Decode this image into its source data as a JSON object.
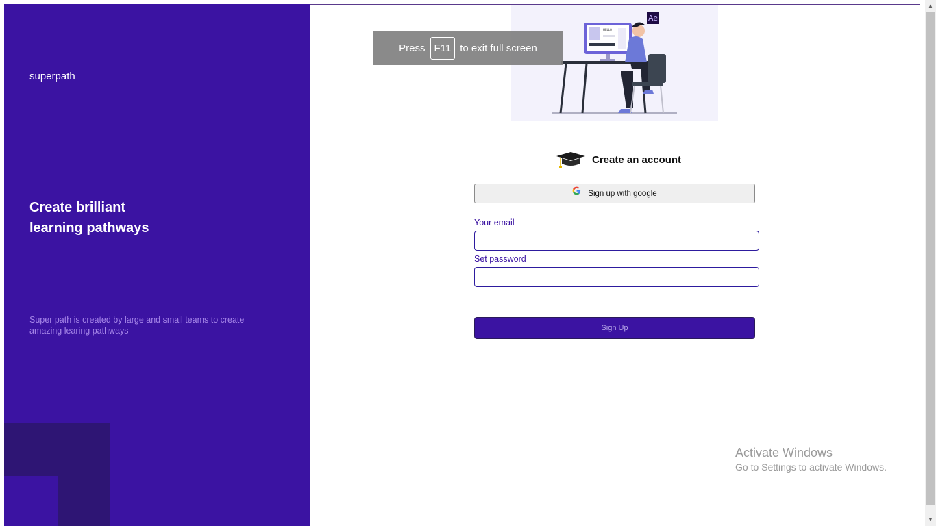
{
  "sidebar": {
    "brand": "superpath",
    "headline_line1": "Create brilliant",
    "headline_line2": "learning pathways",
    "tagline": "Super path is created by large and small teams to create amazing learing pathways",
    "colors": {
      "background": "#3b13a2",
      "tagline": "#a585e8",
      "decor": "#2e1574"
    }
  },
  "fullscreen_notice": {
    "before": "Press",
    "key": "F11",
    "after": "to exit full screen"
  },
  "illustration": {
    "badge": "Ae",
    "screen_text": "HELLO"
  },
  "form": {
    "title": "Create an account",
    "title_icon": "graduation-cap-icon",
    "google_label": "Sign up with google",
    "email_label": "Your email",
    "email_value": "",
    "password_label": "Set password",
    "password_value": "",
    "submit_label": "Sign Up",
    "colors": {
      "accent": "#3b13a2",
      "input_border": "#2d1b9e"
    }
  },
  "watermark": {
    "line1": "Activate Windows",
    "line2": "Go to Settings to activate Windows."
  }
}
